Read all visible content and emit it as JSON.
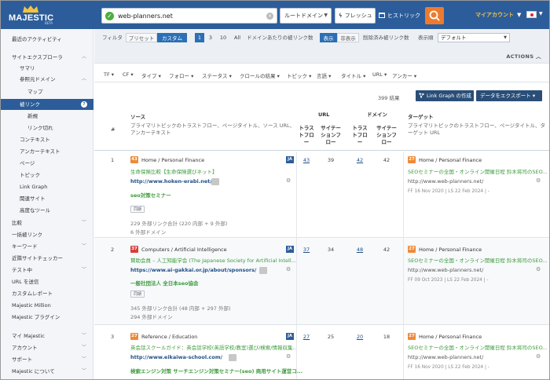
{
  "header": {
    "logo": "MAJESTIC",
    "logo_sub": "BETA",
    "search_value": "web-planners.net",
    "scope": "ルートドメイン",
    "fresh": "フレッシュ",
    "history": "ヒストリック",
    "account": "マイアカウント"
  },
  "sidebar": {
    "items": [
      {
        "label": "最近のアクティビティ"
      },
      {
        "label": "サイトエクスプローラ"
      },
      {
        "label": "サマリ"
      },
      {
        "label": "参照元ドメイン"
      },
      {
        "label": "マップ"
      },
      {
        "label": "被リンク"
      },
      {
        "label": "新規"
      },
      {
        "label": "リンク切れ"
      },
      {
        "label": "コンテキスト"
      },
      {
        "label": "アンカーテキスト"
      },
      {
        "label": "ページ"
      },
      {
        "label": "トピック"
      },
      {
        "label": "Link Graph"
      },
      {
        "label": "関連サイト"
      },
      {
        "label": "高度なツール"
      },
      {
        "label": "比較"
      },
      {
        "label": "一括被リンク"
      },
      {
        "label": "キーワード"
      },
      {
        "label": "近隣サイトチェッカー"
      },
      {
        "label": "テスト中"
      },
      {
        "label": "URL を送信"
      },
      {
        "label": "カスタムレポート"
      },
      {
        "label": "Majestic Million"
      },
      {
        "label": "Majestic プラグイン"
      },
      {
        "label": "マイ Majestic"
      },
      {
        "label": "アカウント"
      },
      {
        "label": "サポート"
      },
      {
        "label": "Majestic について"
      }
    ]
  },
  "filterbar": {
    "filter_label": "フィルタ",
    "preset_label": "プリセット",
    "custom_label": "カスタム",
    "per_domain": [
      "1",
      "3",
      "10",
      "All"
    ],
    "per_domain_label": "ドメインあたりの被リンク数",
    "show_label": "表示",
    "hide_label": "非表示",
    "deleted_label": "削除済み被リンク数",
    "display_label": "表示順",
    "sort_value": "デフォルト",
    "actions": "ACTIONS"
  },
  "column_filters": [
    "TF",
    "CF",
    "タイプ",
    "フォロー",
    "ステータス",
    "クロールの結果",
    "トピック",
    "言語",
    "タイトル",
    "URL",
    "アンカー"
  ],
  "results": {
    "count": "399 結果",
    "link_graph_btn": "Link Graph の作成",
    "export_btn": "データをエクスポート"
  },
  "table_header": {
    "num": "#",
    "source": "ソース",
    "source_desc": "プライマリトピックのトラストフロー、ページタイトル、ソース URL、アンカーテキスト",
    "url_group": "URL",
    "domain_group": "ドメイン",
    "trust_flow": "トラストフロー",
    "citation_flow": "サイテーションフロー",
    "target": "ターゲット",
    "target_desc": "プライマリトピックのトラストフロー、ページタイトル、ターゲット URL"
  },
  "rows": [
    {
      "num": "1",
      "tf": "43",
      "topic": "Home / Personal Finance",
      "lang": "JA",
      "title": "生命保険比較【生命保険選びネット】",
      "url": "http://www.hoken-erabi.net/",
      "anchor": "seo対策セミナー",
      "tag": "同期",
      "links": "229 外部リンク合計 (220 内部 + 9 外部)",
      "domains": "6 外部ドメイン",
      "url_tf": "43",
      "url_cf": "39",
      "dom_tf": "42",
      "dom_cf": "42",
      "target_tf": "27",
      "target_topic": "Home / Personal Finance",
      "target_title": "SEOセミナーの全国・オンライン開催日程 鈴木将司のSEO...",
      "target_url": "http://www.web-planners.net/",
      "dates": "FF 16 Nov 2020 | LS 22 Feb 2024 | -"
    },
    {
      "num": "2",
      "tf": "37",
      "topic": "Computers / Artificial Intelligence",
      "lang": "JA",
      "title": "賛助会員 – 人工知能学会 (The Japanese Society for Artificial Intell...",
      "url": "https://www.ai-gakkai.or.jp/about/sponsors/",
      "anchor": "一般社団法人 全日本seo協会",
      "tag": "同期",
      "links": "345 外部リンク合計 (48 内部 + 297 外部)",
      "domains": "294 外部ドメイン",
      "url_tf": "37",
      "url_cf": "34",
      "dom_tf": "48",
      "dom_cf": "42",
      "target_tf": "27",
      "target_topic": "Home / Personal Finance",
      "target_title": "SEOセミナーの全国・オンライン開催日程 鈴木将司のSEO...",
      "target_url": "http://www.web-planners.net/",
      "dates": "FF 09 Oct 2023 | LS 22 Feb 2024 | -"
    },
    {
      "num": "3",
      "tf": "27",
      "topic": "Reference / Education",
      "lang": "JA",
      "title": "英会話スクールガイド：英会話学校(英語学校/教室)選び/検索/情報収集...",
      "url": "http://www.eikaiwa-school.com/",
      "anchor": "検索エンジン対策 サーチエンジン対策セミナー(seo) 商用サイト運営コ...",
      "url_tf": "27",
      "url_cf": "25",
      "dom_tf": "20",
      "dom_cf": "18",
      "target_tf": "27",
      "target_topic": "Home / Personal Finance",
      "target_title": "SEOセミナーの全国・オンライン開催日程 鈴木将司のSEO...",
      "target_url": "http://www.web-planners.net/",
      "dates": "FF 16 Nov 2020 | LS 22 Feb 2024 | -"
    }
  ]
}
